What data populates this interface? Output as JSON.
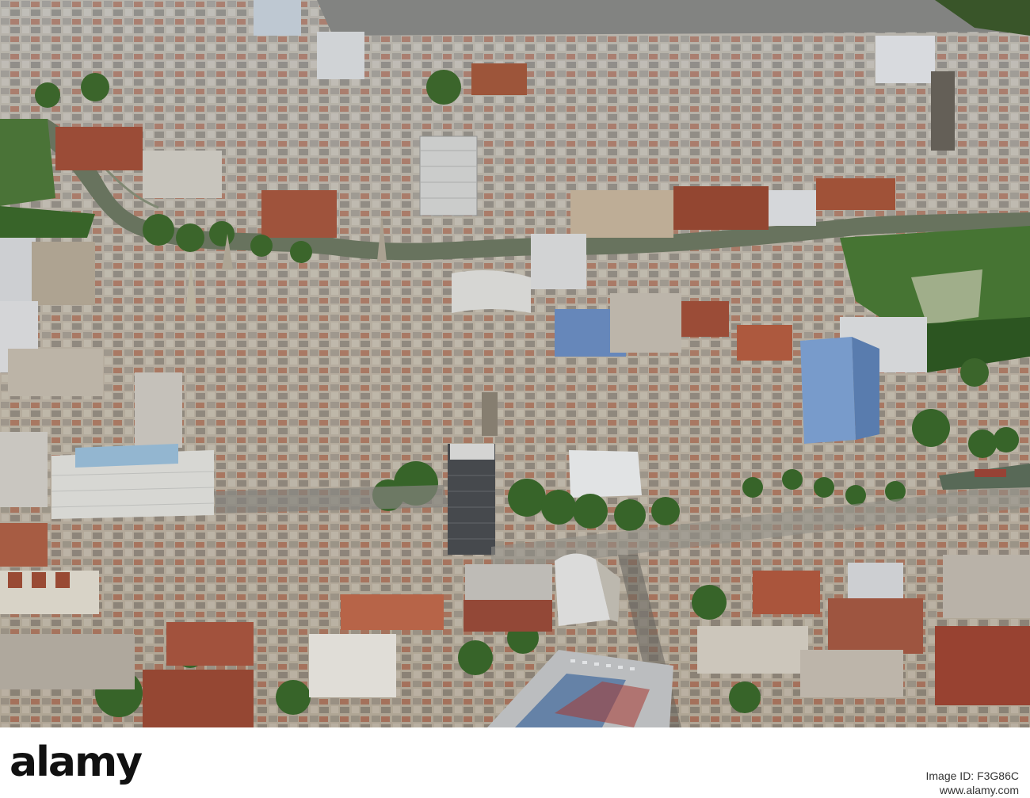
{
  "photo": {
    "subject": "aerial view of a dense city centre with a river, towers, streets and trees",
    "palette": {
      "stone": "#cfc8bb",
      "brick": "#a4543c",
      "roof_grey": "#8e9196",
      "water": "#6f7d68",
      "foliage": "#3f6b2e",
      "glass_blue": "#8fb1d6",
      "shadow": "#3c3a36"
    }
  },
  "footer": {
    "brand": "alamy",
    "image_id_label": "Image ID: F3G86C",
    "site": "www.alamy.com"
  }
}
